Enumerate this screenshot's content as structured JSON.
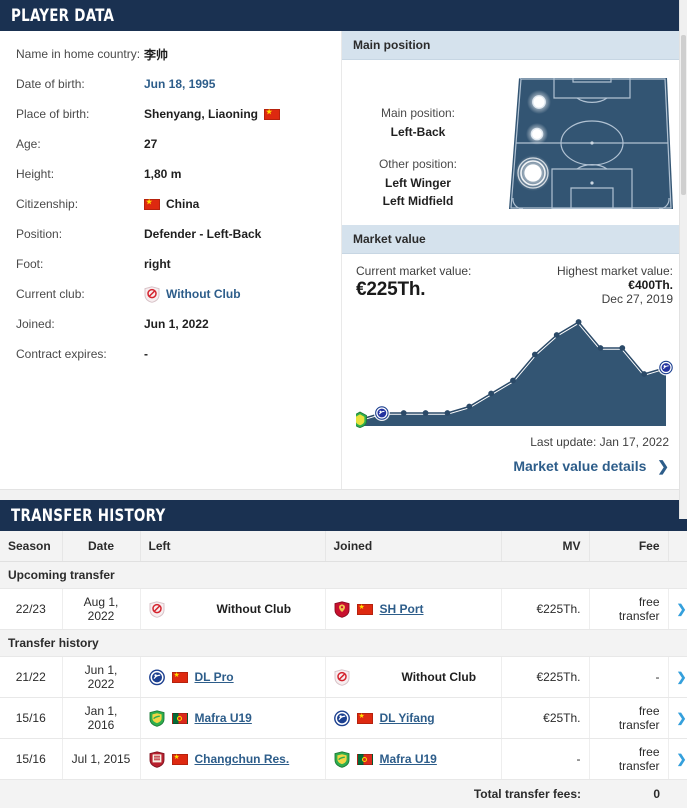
{
  "player_data": {
    "header": "PLAYER DATA",
    "rows": [
      {
        "label": "Name in home country:",
        "value": "李帅",
        "type": "text"
      },
      {
        "label": "Date of birth:",
        "value": "Jun 18, 1995",
        "type": "link"
      },
      {
        "label": "Place of birth:",
        "value": "Shenyang, Liaoning",
        "type": "text",
        "flag": "cn"
      },
      {
        "label": "Age:",
        "value": "27",
        "type": "text"
      },
      {
        "label": "Height:",
        "value": "1,80 m",
        "type": "text"
      },
      {
        "label": "Citizenship:",
        "value": "China",
        "type": "text",
        "flag_before": "cn"
      },
      {
        "label": "Position:",
        "value": "Defender - Left-Back",
        "type": "text"
      },
      {
        "label": "Foot:",
        "value": "right",
        "type": "text"
      },
      {
        "label": "Current club:",
        "value": "Without Club",
        "type": "link",
        "crest": "without-club"
      },
      {
        "label": "Joined:",
        "value": "Jun 1, 2022",
        "type": "text"
      },
      {
        "label": "Contract expires:",
        "value": "-",
        "type": "text"
      }
    ]
  },
  "main_position": {
    "header": "Main position",
    "main_caption": "Main position:",
    "main_value": "Left-Back",
    "other_caption": "Other position:",
    "other_values": [
      "Left Winger",
      "Left Midfield"
    ]
  },
  "market_value": {
    "header": "Market value",
    "current_caption": "Current market value:",
    "current_value": "€225Th.",
    "highest_caption": "Highest market value:",
    "highest_value": "€400Th.",
    "highest_date": "Dec 27, 2019",
    "last_update": "Last update: Jan 17, 2022",
    "details_link": "Market value details",
    "details_chevron": "chevron-right-icon"
  },
  "chart_data": {
    "type": "area",
    "title": "Market value development",
    "xlabel": "",
    "ylabel": "Market value",
    "ylim": [
      0,
      400
    ],
    "grid": false,
    "legend": false,
    "area_color": "#335573",
    "line_color": "#2b4a68",
    "marker_color": "#2b4a68",
    "points": [
      {
        "x": 0,
        "y": 25,
        "marker": "club-badge-green"
      },
      {
        "x": 1,
        "y": 50,
        "marker": "club-badge-blue"
      },
      {
        "x": 2,
        "y": 50,
        "marker": "dot"
      },
      {
        "x": 3,
        "y": 50,
        "marker": "dot"
      },
      {
        "x": 4,
        "y": 50,
        "marker": "dot"
      },
      {
        "x": 5,
        "y": 75,
        "marker": "dot"
      },
      {
        "x": 6,
        "y": 125,
        "marker": "dot"
      },
      {
        "x": 7,
        "y": 175,
        "marker": "dot"
      },
      {
        "x": 8,
        "y": 275,
        "marker": "dot"
      },
      {
        "x": 9,
        "y": 350,
        "marker": "dot"
      },
      {
        "x": 10,
        "y": 400,
        "marker": "dot"
      },
      {
        "x": 11,
        "y": 300,
        "marker": "dot"
      },
      {
        "x": 12,
        "y": 300,
        "marker": "dot"
      },
      {
        "x": 13,
        "y": 200,
        "marker": "dot"
      },
      {
        "x": 14,
        "y": 225,
        "marker": "club-badge-blue"
      }
    ]
  },
  "transfer_history": {
    "header": "TRANSFER HISTORY",
    "columns": [
      "Season",
      "Date",
      "Left",
      "Joined",
      "MV",
      "Fee"
    ],
    "groups": [
      {
        "title": "Upcoming transfer",
        "rows": [
          {
            "season": "22/23",
            "date": "Aug 1, 2022",
            "left": {
              "name": "Without Club",
              "crest": "without-club",
              "flag": "",
              "link": false
            },
            "joined": {
              "name": "SH Port",
              "crest": "sh-port",
              "flag": "cn",
              "link": true
            },
            "mv": "€225Th.",
            "fee": "free transfer"
          }
        ]
      },
      {
        "title": "Transfer history",
        "rows": [
          {
            "season": "21/22",
            "date": "Jun 1, 2022",
            "left": {
              "name": "DL Pro",
              "crest": "dl-pro",
              "flag": "cn",
              "link": true
            },
            "joined": {
              "name": "Without Club",
              "crest": "without-club",
              "flag": "",
              "link": false
            },
            "mv": "€225Th.",
            "fee": "-"
          },
          {
            "season": "15/16",
            "date": "Jan 1, 2016",
            "left": {
              "name": "Mafra U19",
              "crest": "mafra",
              "flag": "pt",
              "link": true
            },
            "joined": {
              "name": "DL Yifang",
              "crest": "dl-pro",
              "flag": "cn",
              "link": true
            },
            "mv": "€25Th.",
            "fee": "free transfer"
          },
          {
            "season": "15/16",
            "date": "Jul 1, 2015",
            "left": {
              "name": "Changchun Res.",
              "crest": "changchun",
              "flag": "cn",
              "link": true
            },
            "joined": {
              "name": "Mafra U19",
              "crest": "mafra",
              "flag": "pt",
              "link": true
            },
            "mv": "-",
            "fee": "free transfer"
          }
        ]
      }
    ],
    "total_label": "Total transfer fees:",
    "total_value": "0",
    "row_arrow": "chevron-right-icon"
  }
}
